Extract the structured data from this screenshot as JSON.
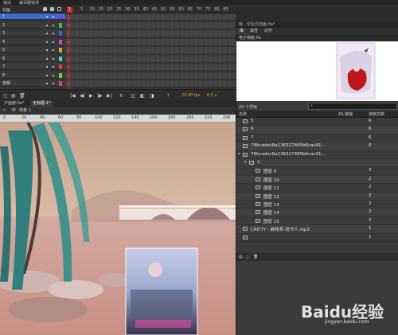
{
  "top_tabs": [
    "输出",
    "编译器错误"
  ],
  "timeline": {
    "header_layer": "对画",
    "ruler_ticks": [
      "1",
      "5",
      "10",
      "15",
      "20",
      "25",
      "30",
      "35",
      "40",
      "45",
      "50",
      "55",
      "60",
      "65",
      "70",
      "75",
      "80",
      "85"
    ],
    "current_frame": "1",
    "layers": [
      {
        "name": "1",
        "color": "#7b3fd9",
        "selected": true
      },
      {
        "name": "2",
        "color": "#3fbd3f",
        "selected": false
      },
      {
        "name": "3",
        "color": "#3f5fe0",
        "selected": false
      },
      {
        "name": "4",
        "color": "#d43fd4",
        "selected": false
      },
      {
        "name": "5",
        "color": "#e0a03f",
        "selected": false
      },
      {
        "name": "6",
        "color": "#3fd4d4",
        "selected": false
      },
      {
        "name": "7",
        "color": "#e03f3f",
        "selected": false
      },
      {
        "name": "8",
        "color": "#7bd43f",
        "selected": false
      },
      {
        "name": "音频",
        "color": "#d43fa0",
        "selected": false
      }
    ],
    "footer": {
      "frame": "1",
      "fps": "24.00 fps",
      "time": "0.0 s"
    }
  },
  "library": {
    "panel_title": "库 - 交互式动画.fla*",
    "tabs": [
      "库",
      "属性",
      "动作"
    ],
    "active_tab": "库",
    "document": "电子相册.fla",
    "count_label": "29 个项目",
    "columns": {
      "name": "名称",
      "linkage": "AS 链接",
      "use_count": "使用次数"
    },
    "items": [
      {
        "name": "5",
        "count": "6",
        "indent": 0,
        "type": "symbol"
      },
      {
        "name": "6",
        "count": "6",
        "indent": 0,
        "type": "symbol"
      },
      {
        "name": "7",
        "count": "6",
        "indent": 0,
        "type": "symbol"
      },
      {
        "name": "78bcadec8a136327465b6cac91...",
        "count": "0",
        "indent": 0,
        "type": "bitmap"
      },
      {
        "name": "78bcadec8a136327465b6cac91...",
        "count": "",
        "indent": 0,
        "type": "folder"
      },
      {
        "name": "1",
        "count": "",
        "indent": 1,
        "type": "folder"
      },
      {
        "name": "图层 9",
        "count": "3",
        "indent": 2,
        "type": "bitmap"
      },
      {
        "name": "图层 10",
        "count": "2",
        "indent": 2,
        "type": "bitmap"
      },
      {
        "name": "图层 11",
        "count": "2",
        "indent": 2,
        "type": "bitmap"
      },
      {
        "name": "图层 12",
        "count": "2",
        "indent": 2,
        "type": "bitmap"
      },
      {
        "name": "图层 13",
        "count": "2",
        "indent": 2,
        "type": "bitmap"
      },
      {
        "name": "图层 14",
        "count": "2",
        "indent": 2,
        "type": "bitmap"
      },
      {
        "name": "图层 15",
        "count": "2",
        "indent": 2,
        "type": "bitmap"
      },
      {
        "name": "CRITTY - 麻枝系-说书人.mp3",
        "count": "1",
        "indent": 0,
        "type": "audio"
      },
      {
        "name": "",
        "count": "1",
        "indent": 0,
        "type": "symbol"
      }
    ]
  },
  "document_tabs": [
    "户画册.fla*",
    "无标题-1*"
  ],
  "active_document": "无标题-1*",
  "edit_bar": {
    "scene": "场景 1"
  },
  "ruler_labels": [
    "0",
    "20",
    "40",
    "60",
    "80",
    "100",
    "120",
    "140",
    "160",
    "180",
    "200",
    "220",
    "240"
  ],
  "watermark": {
    "text": "Baidu经验",
    "sub": "jingyan.baidu.com"
  }
}
